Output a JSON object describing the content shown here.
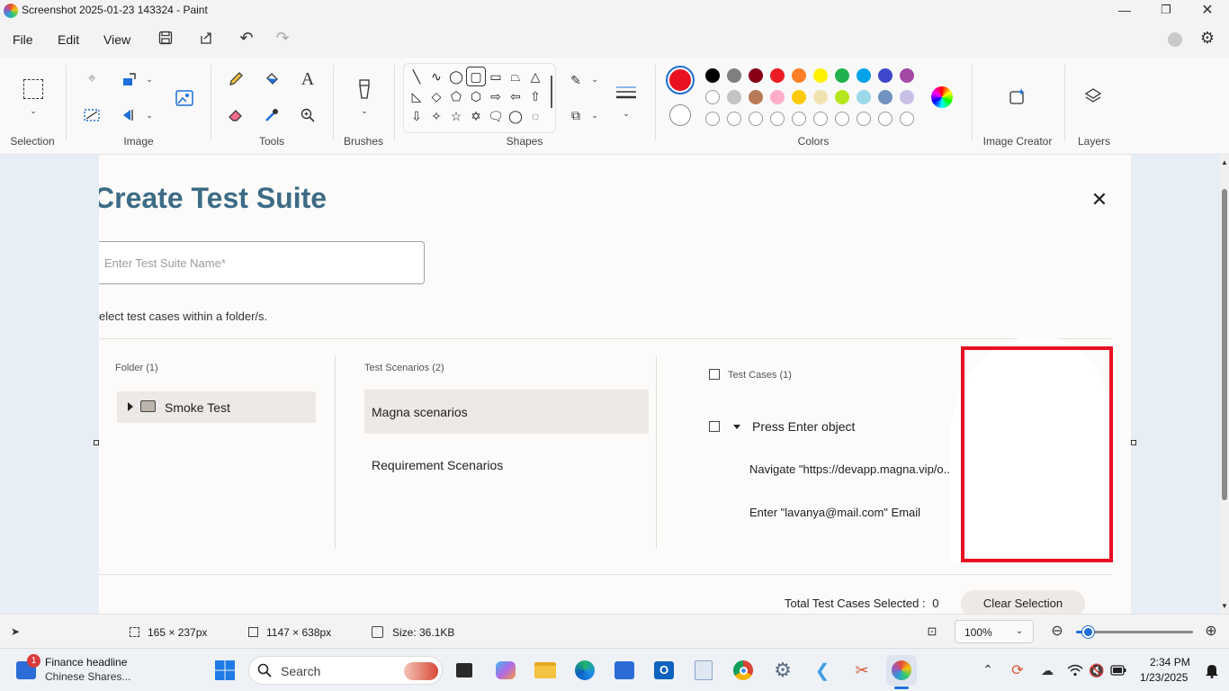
{
  "window": {
    "title": "Screenshot 2025-01-23 143324 - Paint"
  },
  "menu": {
    "file": "File",
    "edit": "Edit",
    "view": "View"
  },
  "ribbon": {
    "selection_label": "Selection",
    "image_label": "Image",
    "tools_label": "Tools",
    "brushes_label": "Brushes",
    "shapes_label": "Shapes",
    "colors_label": "Colors",
    "image_creator_label": "Image Creator",
    "layers_label": "Layers",
    "active_color": "#e81123",
    "palette_row1": [
      "#000000",
      "#7f7f7f",
      "#880015",
      "#ed1c24",
      "#ff7f27",
      "#fff200",
      "#22b14c",
      "#00a2e8",
      "#3f48cc",
      "#a349a4"
    ],
    "palette_row2": [
      "#ffffff",
      "#c3c3c3",
      "#b97a57",
      "#ffaec9",
      "#ffc90e",
      "#efe4b0",
      "#b5e61d",
      "#99d9ea",
      "#7092be",
      "#c8bfe7"
    ]
  },
  "doc": {
    "heading": "Create Test Suite",
    "name_placeholder": "Enter Test Suite Name*",
    "instruction": "elect test cases within a folder/s.",
    "folder_header": "Folder (1)",
    "folder_item": "Smoke Test",
    "scenarios_header": "Test Scenarios (2)",
    "scenario_1": "Magna scenarios",
    "scenario_2": "Requirement Scenarios",
    "cases_header": "Test Cases (1)",
    "case_1": "Press Enter object",
    "step_1": "Navigate \"https://devapp.magna.vip/o...",
    "step_2": "Enter \"lavanya@mail.com\" Email",
    "total_label": "Total Test Cases Selected :",
    "total_value": "0",
    "clear_button": "Clear Selection"
  },
  "status": {
    "selection_size": "165 × 237px",
    "canvas_size": "1147 × 638px",
    "file_size": "Size: 36.1KB",
    "zoom": "100%",
    "zoom_slider_fraction": 0.1
  },
  "taskbar": {
    "news_title": "Finance headline",
    "news_sub": "Chinese Shares...",
    "news_badge": "1",
    "search": "Search",
    "time": "2:34 PM",
    "date": "1/23/2025"
  }
}
